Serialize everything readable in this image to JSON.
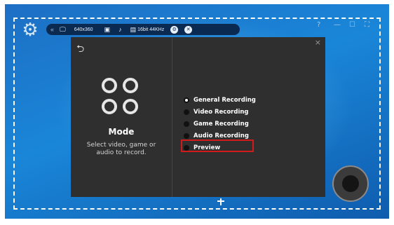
{
  "toolbar": {
    "resolution": "640x360",
    "audio_format": "16bit 44KHz",
    "icons": [
      "chevron-left-icon",
      "monitor-icon",
      "camera-icon",
      "music-note-icon",
      "speaker-icon",
      "settings-circle-icon",
      "close-circle-icon"
    ]
  },
  "window_controls": {
    "help": "?",
    "minimize": "—",
    "maximize": "☐",
    "close": "⛶"
  },
  "panel": {
    "back": "⮌",
    "close": "×",
    "mode_title": "Mode",
    "mode_description": "Select video, game or audio to record.",
    "options": [
      {
        "label": "General Recording",
        "selected": true
      },
      {
        "label": "Video Recording",
        "selected": false
      },
      {
        "label": "Game Recording",
        "selected": false
      },
      {
        "label": "Audio Recording",
        "selected": false
      },
      {
        "label": "Preview",
        "selected": false,
        "highlighted": true
      }
    ]
  },
  "colors": {
    "highlight": "#d11a1a",
    "panel_bg": "#2f2f2f",
    "toolbar_bg": "#0b2a52"
  }
}
